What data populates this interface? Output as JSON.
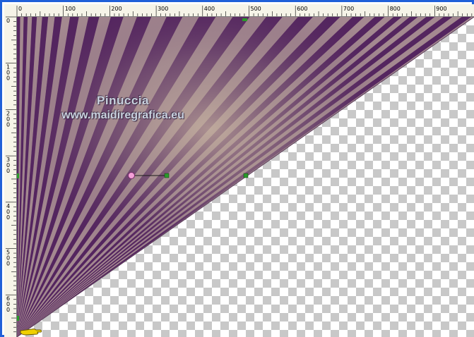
{
  "ruler": {
    "top_labels": [
      "0",
      "100",
      "200",
      "300",
      "400",
      "500",
      "600",
      "700",
      "800",
      "900"
    ],
    "left_labels": [
      "0",
      "100",
      "200",
      "300",
      "400",
      "500",
      "600"
    ]
  },
  "watermark": {
    "line1": "Pinuccia",
    "line2": "www.maidiregrafica.eu"
  },
  "colors": {
    "frame": "#2060d8",
    "ruler_bg": "#f6f4e8",
    "dark_purple": "#4e1f5a",
    "light_tan": "#c9b8a4",
    "handle_green": "#2a9a2a",
    "handle_pink": "#f4a0d8",
    "cursor_yellow": "#f0d000"
  },
  "icons": {
    "cursor": "pointing-hand-icon",
    "rotation_handle": "circle-handle-icon"
  }
}
